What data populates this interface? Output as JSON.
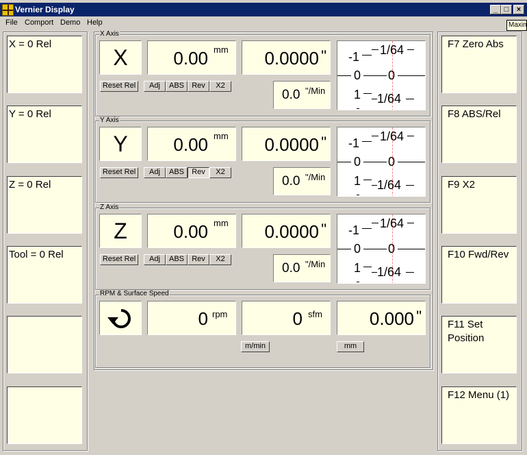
{
  "window": {
    "title": "Vernier Display"
  },
  "menu": [
    "File",
    "Comport",
    "Demo",
    "Help"
  ],
  "tooltip": "Maxim",
  "left_buttons": [
    "X = 0 Rel",
    "Y = 0 Rel",
    "Z = 0 Rel",
    "Tool = 0 Rel",
    "",
    ""
  ],
  "right_buttons": [
    "F7 Zero Abs",
    "F8 ABS/Rel",
    "F9 X2",
    "F10 Fwd/Rev",
    "F11 Set Position",
    "F12 Menu (1)"
  ],
  "axes": [
    {
      "group_label": "X Axis",
      "letter": "X",
      "metric_value": "0.00",
      "metric_unit": "mm",
      "inch_value": "0.0000",
      "inch_unit": "\"",
      "rate_value": "0.0",
      "rate_unit": "\"/Min",
      "buttons": {
        "reset": "Reset Rel",
        "adj": "Adj",
        "abs": "ABS",
        "rev": "Rev",
        "x2": "X2"
      },
      "scale": {
        "top_left": "-1",
        "top_right": "1/64",
        "mid_left": "0",
        "mid_right": "0",
        "bot_left": "1",
        "bot_right": "1/64"
      }
    },
    {
      "group_label": "Y Axis",
      "letter": "Y",
      "metric_value": "0.00",
      "metric_unit": "mm",
      "inch_value": "0.0000",
      "inch_unit": "\"",
      "rate_value": "0.0",
      "rate_unit": "\"/Min",
      "buttons": {
        "reset": "Reset Rel",
        "adj": "Adj",
        "abs": "ABS",
        "rev": "Rev",
        "x2": "X2"
      },
      "scale": {
        "top_left": "-1",
        "top_right": "1/64",
        "mid_left": "0",
        "mid_right": "0",
        "bot_left": "1",
        "bot_right": "1/64"
      }
    },
    {
      "group_label": "Z Axis",
      "letter": "Z",
      "metric_value": "0.00",
      "metric_unit": "mm",
      "inch_value": "0.0000",
      "inch_unit": "\"",
      "rate_value": "0.0",
      "rate_unit": "\"/Min",
      "buttons": {
        "reset": "Reset Rel",
        "adj": "Adj",
        "abs": "ABS",
        "rev": "Rev",
        "x2": "X2"
      },
      "scale": {
        "top_left": "-1",
        "top_right": "1/64",
        "mid_left": "0",
        "mid_right": "0",
        "bot_left": "1",
        "bot_right": "1/64"
      }
    }
  ],
  "rpm": {
    "group_label": "RPM & Surface Speed",
    "icon": "rotate-clockwise-icon",
    "rpm_value": "0",
    "rpm_unit": "rpm",
    "sfm_value": "0",
    "sfm_unit": "sfm",
    "third_value": "0.000",
    "third_unit": "\"",
    "btn_mmin": "m/min",
    "btn_mm": "mm"
  }
}
